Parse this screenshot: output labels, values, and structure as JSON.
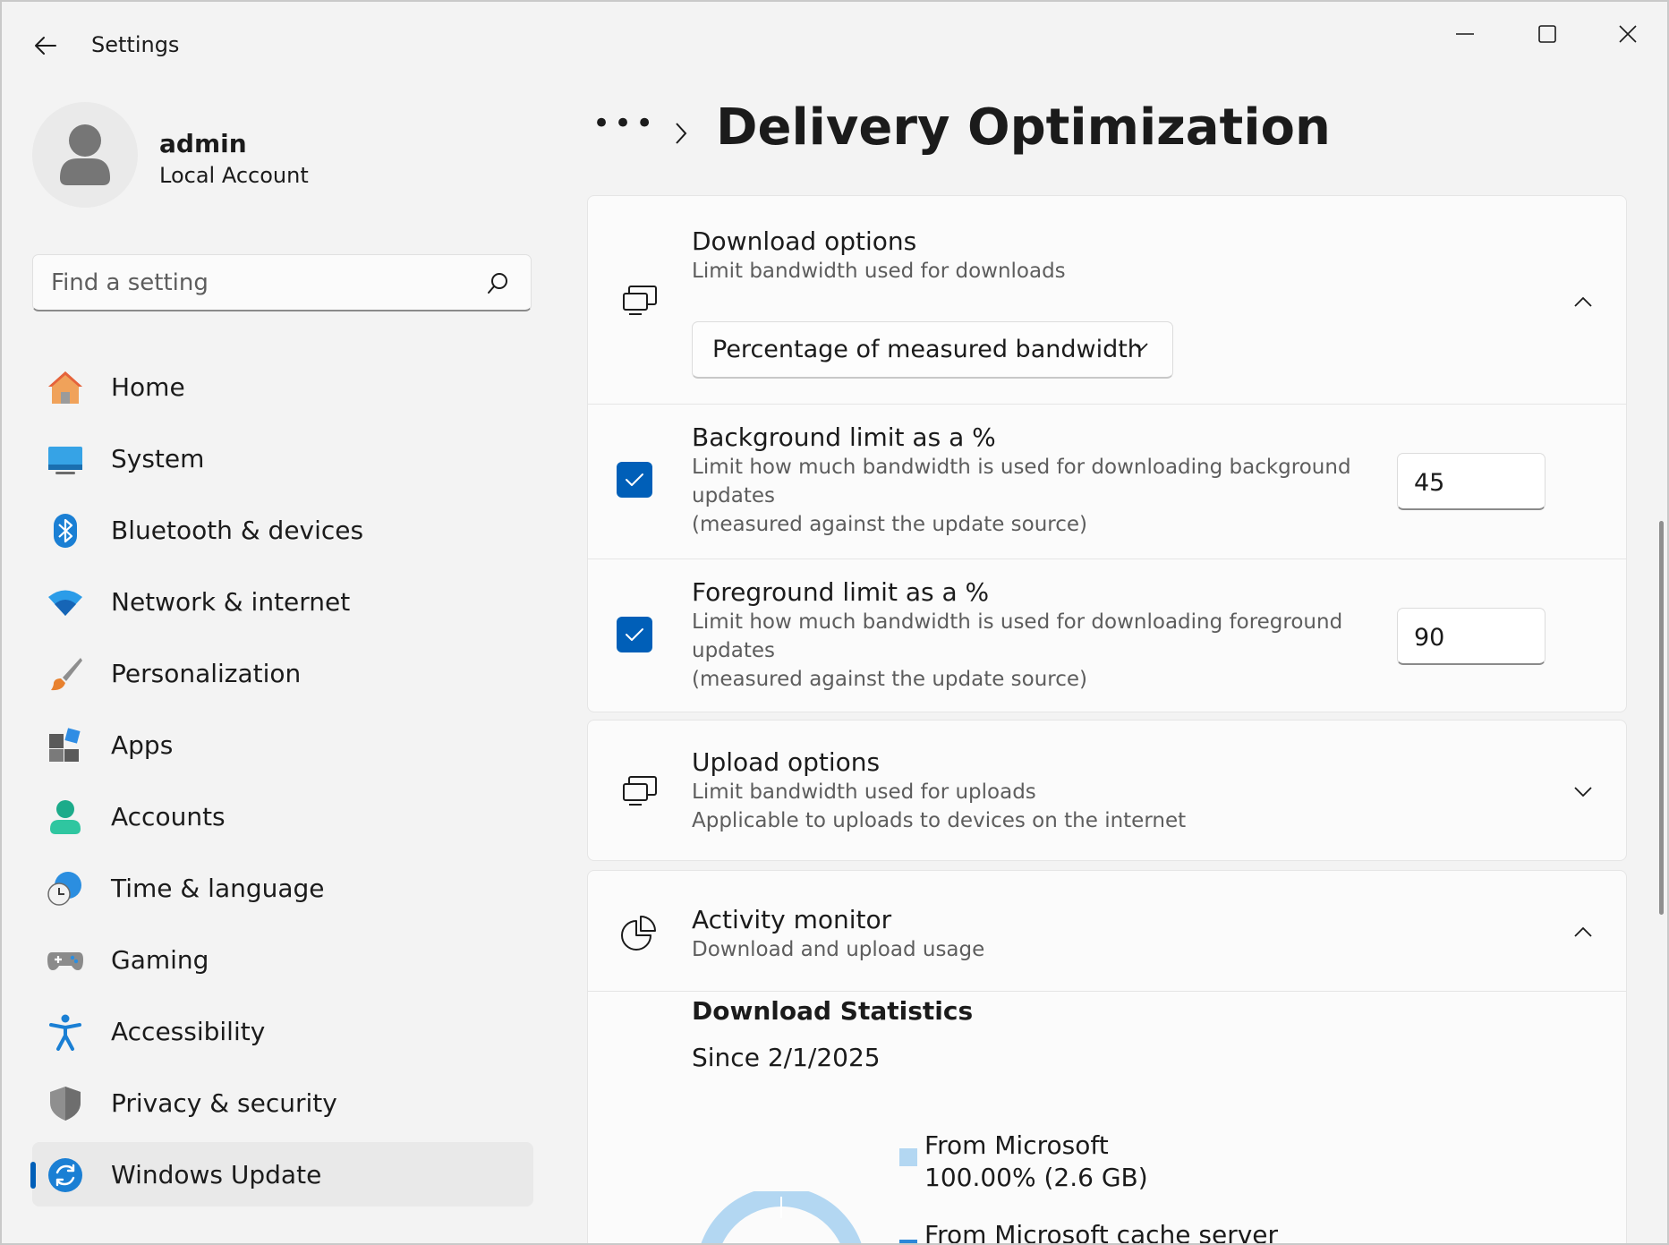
{
  "titlebar": {
    "app_title": "Settings"
  },
  "profile": {
    "name": "admin",
    "account_type": "Local Account"
  },
  "search": {
    "placeholder": "Find a setting"
  },
  "sidebar": {
    "items": [
      {
        "label": "Home",
        "icon": "home-icon"
      },
      {
        "label": "System",
        "icon": "system-icon"
      },
      {
        "label": "Bluetooth & devices",
        "icon": "bluetooth-icon"
      },
      {
        "label": "Network & internet",
        "icon": "wifi-icon"
      },
      {
        "label": "Personalization",
        "icon": "brush-icon"
      },
      {
        "label": "Apps",
        "icon": "apps-icon"
      },
      {
        "label": "Accounts",
        "icon": "accounts-icon"
      },
      {
        "label": "Time & language",
        "icon": "clock-globe-icon"
      },
      {
        "label": "Gaming",
        "icon": "gamepad-icon"
      },
      {
        "label": "Accessibility",
        "icon": "accessibility-icon"
      },
      {
        "label": "Privacy & security",
        "icon": "shield-icon"
      },
      {
        "label": "Windows Update",
        "icon": "update-icon",
        "selected": true
      }
    ]
  },
  "breadcrumb": {
    "overflow": "•••",
    "title": "Delivery Optimization"
  },
  "download_options": {
    "title": "Download options",
    "description": "Limit bandwidth used for downloads",
    "expanded": true,
    "dropdown_value": "Percentage of measured bandwidth",
    "background": {
      "title": "Background limit as a %",
      "desc_line1": "Limit how much bandwidth is used for downloading background",
      "desc_line2": "updates",
      "desc_line3": "(measured against the update source)",
      "checked": true,
      "value": "45"
    },
    "foreground": {
      "title": "Foreground limit as a %",
      "desc_line1": "Limit how much bandwidth is used for downloading foreground",
      "desc_line2": "updates",
      "desc_line3": "(measured against the update source)",
      "checked": true,
      "value": "90"
    }
  },
  "upload_options": {
    "title": "Upload options",
    "desc_line1": "Limit bandwidth used for uploads",
    "desc_line2": "Applicable to uploads to devices on the internet",
    "expanded": false
  },
  "activity_monitor": {
    "title": "Activity monitor",
    "description": "Download and upload usage",
    "expanded": true,
    "stats_title": "Download Statistics",
    "since": "Since 2/1/2025",
    "legend": [
      {
        "label": "From Microsoft",
        "value": "100.00%  (2.6 GB)",
        "color": "#b3d7f2"
      },
      {
        "label": "From Microsoft cache server",
        "color": "#2b88d8"
      }
    ]
  },
  "colors": {
    "accent": "#005fb8",
    "background": "#f3f3f3",
    "card": "#fbfbfb"
  }
}
